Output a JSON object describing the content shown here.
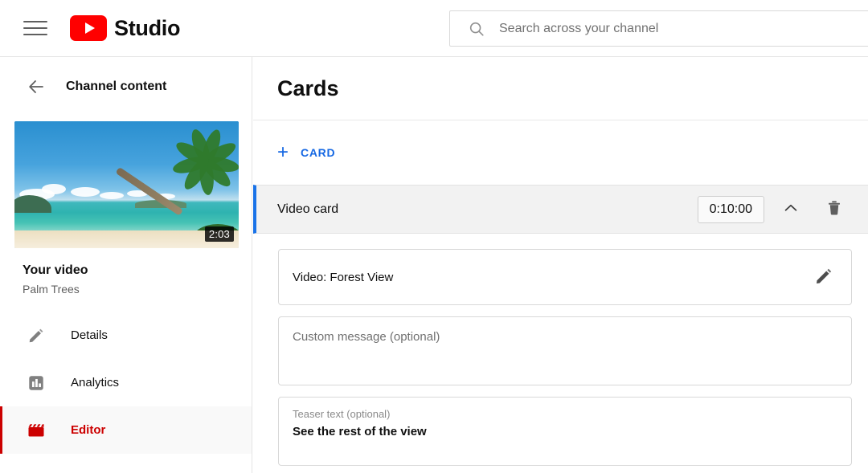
{
  "header": {
    "menu_icon": "hamburger-menu-icon",
    "logo_icon": "youtube-play-icon",
    "brand": "Studio",
    "search": {
      "icon": "search-icon",
      "placeholder": "Search across your channel",
      "value": ""
    }
  },
  "sidebar": {
    "back_icon": "arrow-left-icon",
    "back_label": "Channel content",
    "video": {
      "thumbnail_icon": "video-thumbnail",
      "duration": "2:03",
      "title": "Your video",
      "subtitle": "Palm Trees"
    },
    "items": [
      {
        "icon": "pencil-icon",
        "label": "Details",
        "active": false
      },
      {
        "icon": "analytics-bar-chart-icon",
        "label": "Analytics",
        "active": false
      },
      {
        "icon": "clapperboard-icon",
        "label": "Editor",
        "active": true
      }
    ]
  },
  "main": {
    "page_title": "Cards",
    "add_card": {
      "icon": "plus-icon",
      "label": "CARD"
    },
    "card": {
      "title": "Video card",
      "timestamp": "0:10:00",
      "collapse_icon": "chevron-up-icon",
      "delete_icon": "trash-icon",
      "video_field": {
        "value": "Video: Forest View",
        "edit_icon": "pencil-icon"
      },
      "custom_message": {
        "placeholder": "Custom message (optional)",
        "value": ""
      },
      "teaser_text": {
        "label": "Teaser text (optional)",
        "value": "See the rest of the view"
      }
    }
  },
  "colors": {
    "youtube_red": "#ff0000",
    "active_red": "#cc0000",
    "link_blue": "#1668e3",
    "card_accent_blue": "#1a73e8"
  }
}
